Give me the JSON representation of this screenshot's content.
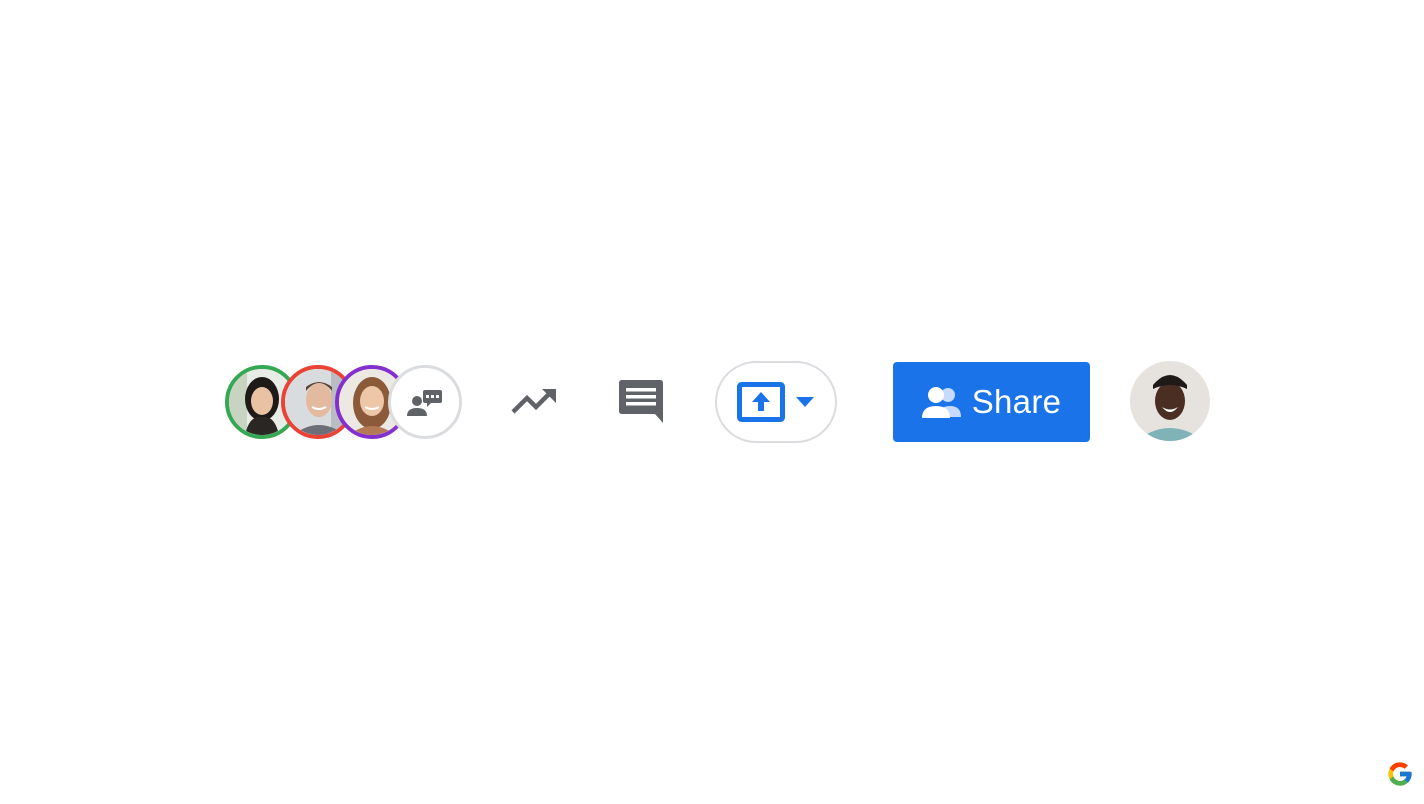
{
  "toolbar": {
    "participants": [
      {
        "name": "participant-1",
        "ring_color": "#34a853"
      },
      {
        "name": "participant-2",
        "ring_color": "#ea4335"
      },
      {
        "name": "participant-3",
        "ring_color": "#8430ce"
      }
    ],
    "more_participants_icon": "person-chat-icon",
    "activity_icon": "trending-up-icon",
    "chat_icon": "comment-icon",
    "present_icon": "present-to-all-icon",
    "present_dropdown_icon": "arrow-drop-down-icon",
    "share": {
      "label": "Share",
      "icon": "people-icon",
      "color": "#1a73e8"
    },
    "account_avatar": "user-avatar"
  },
  "watermark": "google-g-logo",
  "colors": {
    "accent": "#1a73e8",
    "icon_gray": "#5f6368",
    "border": "#dadce0"
  }
}
